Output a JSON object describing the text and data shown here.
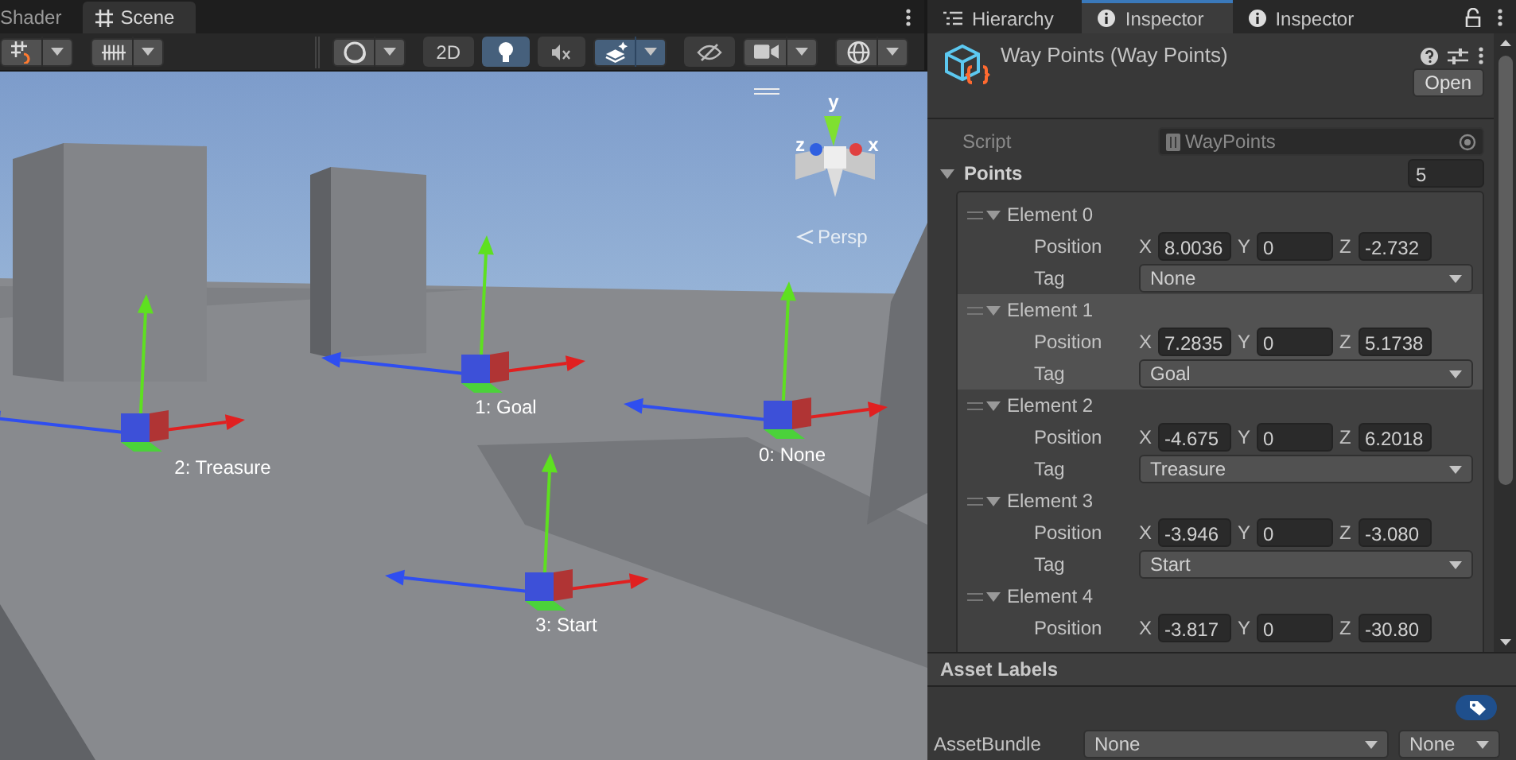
{
  "scene_tabs": [
    {
      "label": "Shader",
      "kind": "plain",
      "selected": false
    },
    {
      "label": "Scene",
      "kind": "scene",
      "selected": true
    }
  ],
  "scene_toolbar": {
    "left": [
      {
        "kind": "snap",
        "dropdown": true,
        "on": false
      },
      {
        "kind": "ruler",
        "dropdown": true,
        "on": false
      }
    ],
    "right": [
      {
        "kind": "shading",
        "dropdown": true,
        "on": false
      },
      {
        "kind": "text",
        "label": "2D",
        "dropdown": false,
        "on": false
      },
      {
        "kind": "light",
        "dropdown": false,
        "on": true
      },
      {
        "kind": "audio",
        "dropdown": false,
        "on": false
      },
      {
        "kind": "effects",
        "dropdown": true,
        "on": true
      },
      {
        "kind": "hidden",
        "dropdown": false,
        "on": false
      },
      {
        "kind": "camera",
        "dropdown": true,
        "on": false
      },
      {
        "kind": "gizmos",
        "dropdown": true,
        "on": false
      }
    ]
  },
  "scene_view": {
    "orientation_gizmo": {
      "y": "y",
      "z": "z",
      "x": "x",
      "projection": "Persp"
    },
    "waypoints": [
      {
        "label": "0: None"
      },
      {
        "label": "1: Goal"
      },
      {
        "label": "2: Treasure"
      },
      {
        "label": "3: Start"
      }
    ]
  },
  "inspector_tabs": [
    {
      "label": "Hierarchy",
      "kind": "list",
      "selected": false
    },
    {
      "label": "Inspector",
      "kind": "info",
      "selected": true
    },
    {
      "label": "Inspector",
      "kind": "info",
      "selected": false
    }
  ],
  "inspector": {
    "title": "Way Points (Way Points)",
    "open_button": "Open",
    "script": {
      "label": "Script",
      "value": "WayPoints"
    },
    "points": {
      "label": "Points",
      "count": "5",
      "expanded": true,
      "elements": [
        {
          "name": "Element 0",
          "expanded": true,
          "selected": false,
          "position_label": "Position",
          "position": [
            {
              "axis": "X",
              "value": "8.0036"
            },
            {
              "axis": "Y",
              "value": "0"
            },
            {
              "axis": "Z",
              "value": "-2.732"
            }
          ],
          "tag_label": "Tag",
          "tag": "None"
        },
        {
          "name": "Element 1",
          "expanded": true,
          "selected": true,
          "position_label": "Position",
          "position": [
            {
              "axis": "X",
              "value": "7.2835"
            },
            {
              "axis": "Y",
              "value": "0"
            },
            {
              "axis": "Z",
              "value": "5.1738"
            }
          ],
          "tag_label": "Tag",
          "tag": "Goal"
        },
        {
          "name": "Element 2",
          "expanded": true,
          "selected": false,
          "position_label": "Position",
          "position": [
            {
              "axis": "X",
              "value": "-4.675"
            },
            {
              "axis": "Y",
              "value": "0"
            },
            {
              "axis": "Z",
              "value": "6.2018"
            }
          ],
          "tag_label": "Tag",
          "tag": "Treasure"
        },
        {
          "name": "Element 3",
          "expanded": true,
          "selected": false,
          "position_label": "Position",
          "position": [
            {
              "axis": "X",
              "value": "-3.946"
            },
            {
              "axis": "Y",
              "value": "0"
            },
            {
              "axis": "Z",
              "value": "-3.080"
            }
          ],
          "tag_label": "Tag",
          "tag": "Start"
        },
        {
          "name": "Element 4",
          "expanded": true,
          "selected": false,
          "position_label": "Position",
          "position": [
            {
              "axis": "X",
              "value": "-3.817"
            },
            {
              "axis": "Y",
              "value": "0"
            },
            {
              "axis": "Z",
              "value": "-30.80"
            }
          ]
        }
      ]
    }
  },
  "asset_labels": {
    "title": "Asset Labels",
    "bundle_label": "AssetBundle",
    "bundle": "None",
    "variant": "None"
  }
}
